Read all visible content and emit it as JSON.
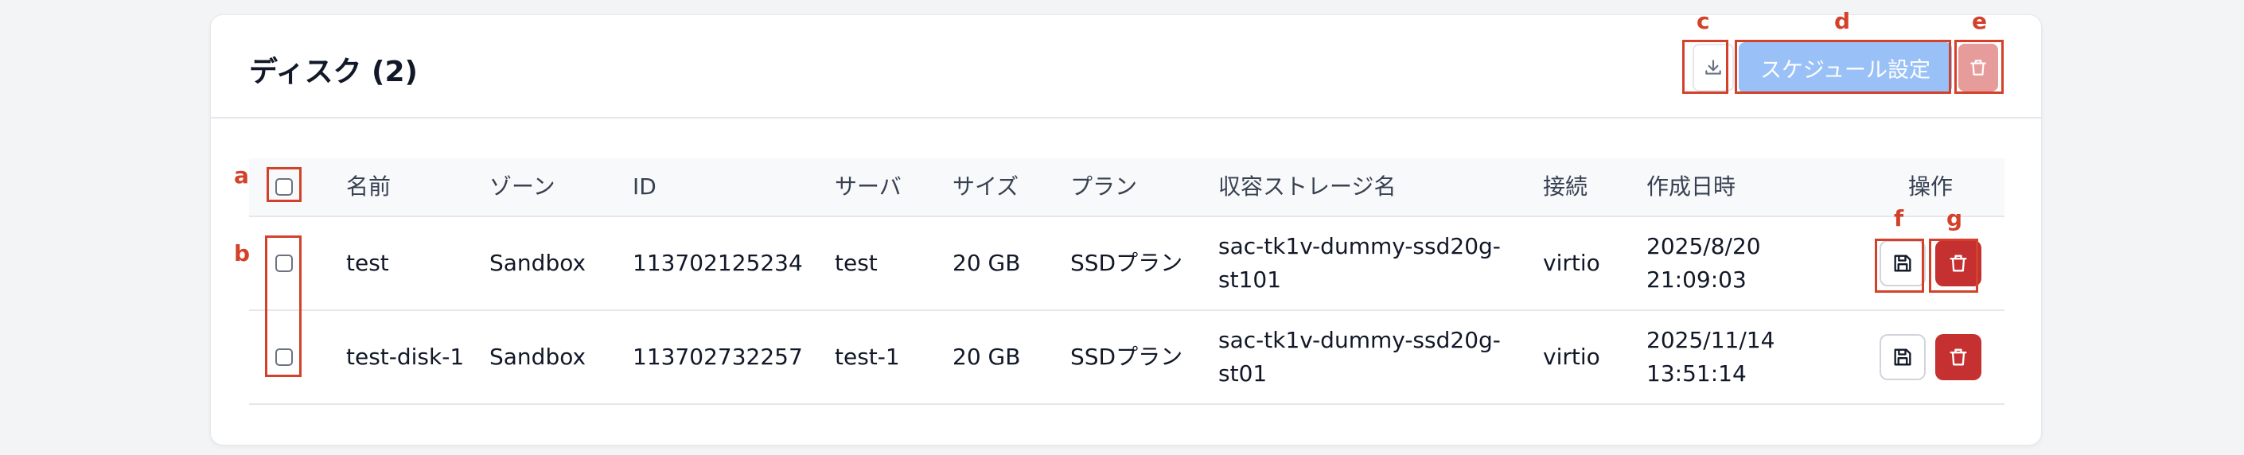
{
  "panel": {
    "title": "ディスク (2)",
    "schedule_label": "スケジュール設定",
    "icons": {
      "download": "download-icon",
      "delete": "trash-icon",
      "save": "save-icon"
    }
  },
  "table": {
    "headers": {
      "name": "名前",
      "zone": "ゾーン",
      "id": "ID",
      "server": "サーバ",
      "size": "サイズ",
      "plan": "プラン",
      "storage": "収容ストレージ名",
      "connection": "接続",
      "created": "作成日時",
      "actions": "操作"
    },
    "rows": [
      {
        "name": "test",
        "zone": "Sandbox",
        "id": "113702125234",
        "server": "test",
        "size": "20 GB",
        "plan": "SSDプラン",
        "storage": "sac-tk1v-dummy-ssd20g-st101",
        "connection": "virtio",
        "created": "2025/8/20 21:09:03"
      },
      {
        "name": "test-disk-1",
        "zone": "Sandbox",
        "id": "113702732257",
        "server": "test-1",
        "size": "20 GB",
        "plan": "SSDプラン",
        "storage": "sac-tk1v-dummy-ssd20g-st01",
        "connection": "virtio",
        "created": "2025/11/14 13:51:14"
      }
    ]
  },
  "annotations": {
    "a": "a",
    "b": "b",
    "c": "c",
    "d": "d",
    "e": "e",
    "f": "f",
    "g": "g"
  },
  "colors": {
    "primary_disabled": "#99c1f7",
    "danger": "#c53030",
    "danger_disabled": "#e79c9c",
    "annotation": "#d4412a"
  }
}
